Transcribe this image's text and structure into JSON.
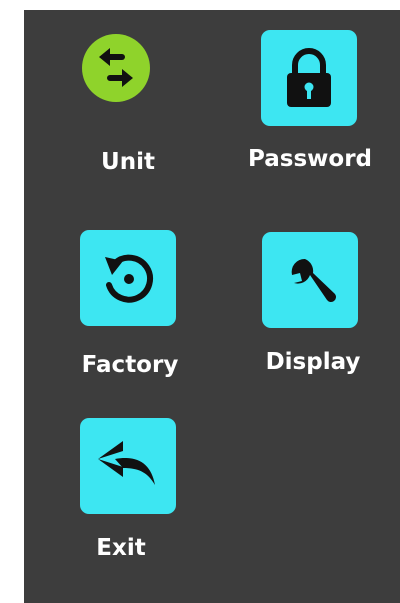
{
  "menu": {
    "items": [
      {
        "label": "Unit",
        "icon": "swap-arrows-icon"
      },
      {
        "label": "Password",
        "icon": "lock-icon"
      },
      {
        "label": "Factory",
        "icon": "reset-icon"
      },
      {
        "label": "Display",
        "icon": "wrench-icon"
      },
      {
        "label": "Exit",
        "icon": "back-arrow-icon"
      }
    ]
  },
  "colors": {
    "panel": "#3d3d3d",
    "tile": "#3de6f2",
    "unit_tile": "#8fd32b",
    "label": "#ffffff",
    "icon": "#111111"
  }
}
